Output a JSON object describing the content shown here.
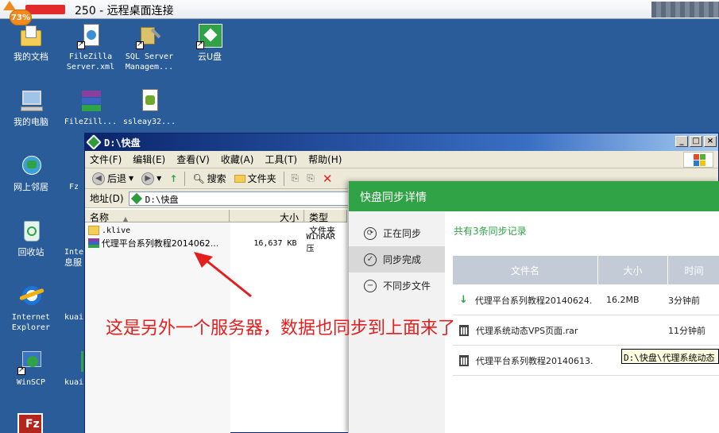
{
  "remote_desktop": {
    "title": "250 - 远程桌面连接",
    "badge": "73%"
  },
  "desktop_icons": [
    {
      "label": "我的文档",
      "icon": "my-documents-icon"
    },
    {
      "label": "FileZilla Server.xml",
      "label_line1": "FileZilla",
      "label_line2": "Server.xml",
      "icon": "xml-file-icon"
    },
    {
      "label": "SQL Server Managem...",
      "label_line1": "SQL Server",
      "label_line2": "Managem...",
      "icon": "sql-server-icon"
    },
    {
      "label": "云U盘",
      "icon": "cloud-disk-icon"
    },
    {
      "label": "我的电脑",
      "icon": "my-computer-icon"
    },
    {
      "label": "FileZill...",
      "icon": "winrar-archive-icon"
    },
    {
      "label": "ssleay32...",
      "icon": "dll-file-icon"
    },
    {
      "label": "网上邻居",
      "icon": "network-icon"
    },
    {
      "label": "Fz",
      "icon": "filezilla-icon"
    },
    {
      "label": "回收站",
      "icon": "recycle-bin-icon"
    },
    {
      "label": "Inte 息服",
      "label_line1": "Inte",
      "label_line2": "息服",
      "icon": "iis-icon"
    },
    {
      "label": "Internet Explorer",
      "label_line1": "Internet",
      "label_line2": "Explorer",
      "icon": "internet-explorer-icon"
    },
    {
      "label": "kuai",
      "icon": "kuaipan-icon"
    },
    {
      "label": "WinSCP",
      "icon": "winscp-icon"
    },
    {
      "label": "kuai",
      "icon": "kuaipan-icon"
    }
  ],
  "explorer": {
    "title": "D:\\快盘",
    "menu": [
      "文件(F)",
      "编辑(E)",
      "查看(V)",
      "收藏(A)",
      "工具(T)",
      "帮助(H)"
    ],
    "toolbar": {
      "back": "后退",
      "search": "搜索",
      "folders": "文件夹"
    },
    "address_label": "地址(D)",
    "address_value": "D:\\快盘",
    "columns": {
      "name": "名称",
      "size": "大小",
      "type": "类型"
    },
    "files": [
      {
        "name": ".klive",
        "size": "",
        "type": "文件夹"
      },
      {
        "name": "代理平台系列教程2014062...",
        "size": "16,637 KB",
        "type": "WinRAR 压"
      }
    ]
  },
  "sync_panel": {
    "title": "快盘同步详情",
    "nav": [
      {
        "label": "正在同步",
        "icon": "sync-icon",
        "active": false
      },
      {
        "label": "同步完成",
        "icon": "check-icon",
        "active": true
      },
      {
        "label": "不同步文件",
        "icon": "minus-icon",
        "active": false
      }
    ],
    "record_count_text": "共有3条同步记录",
    "columns": {
      "name": "文件名",
      "size": "大小",
      "time": "时间"
    },
    "rows": [
      {
        "icon": "download-arrow-icon",
        "name": "代理平台系列教程20140624.",
        "size": "16.2MB",
        "time": "3分钟前"
      },
      {
        "icon": "trash-icon",
        "name": "代理系统动态VPS页面.rar",
        "size": "",
        "time": "11分钟前"
      },
      {
        "icon": "trash-icon",
        "name": "代理平台系列教程20140613.",
        "size": "",
        "time": ""
      }
    ],
    "tooltip": "D:\\快盘\\代理系统动态"
  },
  "annotation": "这是另外一个服务器，数据也同步到上面来了",
  "colors": {
    "sync_green": "#2fa346",
    "annotation_red": "#e31e1e",
    "desktop_blue": "#2a5c9a"
  }
}
